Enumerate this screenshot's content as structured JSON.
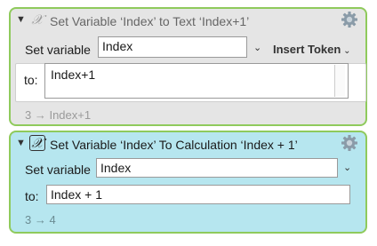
{
  "action1": {
    "title": "Set Variable ‘Index’ to Text ‘Index+1’",
    "set_variable_label": "Set variable",
    "variable_value": "Index",
    "insert_token_label": "Insert Token",
    "to_label": "to:",
    "to_value": "Index+1",
    "result": "3 → Index+1",
    "icon": "x-italic-icon",
    "background": "#e5e5e5"
  },
  "action2": {
    "title": "Set Variable ‘Index’ To Calculation ‘Index + 1’",
    "set_variable_label": "Set variable",
    "variable_value": "Index",
    "to_label": "to:",
    "to_value": "Index + 1",
    "result": "3 → 4",
    "icon": "x-italic-icon",
    "background": "#b6e6ef"
  },
  "colors": {
    "border": "#8fca5c",
    "gear": "#8a9ba8"
  }
}
